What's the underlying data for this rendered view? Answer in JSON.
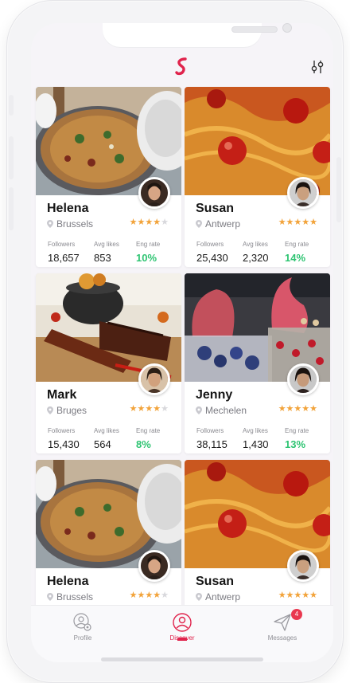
{
  "header": {
    "logo_icon": "app-logo-s-icon",
    "filter_icon": "filter-sliders-icon"
  },
  "labels": {
    "followers": "Followers",
    "avg_likes": "Avg likes",
    "eng_rate": "Eng rate"
  },
  "cards": [
    {
      "name": "Helena",
      "location": "Brussels",
      "rating": 4,
      "followers": "18,657",
      "avg_likes": "853",
      "eng_rate": "10%",
      "image": "pasta-pan"
    },
    {
      "name": "Susan",
      "location": "Antwerp",
      "rating": 5,
      "followers": "25,430",
      "avg_likes": "2,320",
      "eng_rate": "14%",
      "image": "spaghetti-tomato"
    },
    {
      "name": "Mark",
      "location": "Bruges",
      "rating": 4,
      "followers": "15,430",
      "avg_likes": "564",
      "eng_rate": "8%",
      "image": "grilled-meat"
    },
    {
      "name": "Jenny",
      "location": "Mechelen",
      "rating": 5,
      "followers": "38,115",
      "avg_likes": "1,430",
      "eng_rate": "13%",
      "image": "berry-dessert"
    },
    {
      "name": "Helena",
      "location": "Brussels",
      "rating": 4,
      "image": "pasta-pan"
    },
    {
      "name": "Susan",
      "location": "Antwerp",
      "rating": 5,
      "image": "spaghetti-tomato"
    }
  ],
  "tabs": [
    {
      "label": "Profile",
      "icon": "profile-gear-icon"
    },
    {
      "label": "Discover",
      "icon": "discover-user-icon",
      "active": true
    },
    {
      "label": "Messages",
      "icon": "paper-plane-icon",
      "badge": "4"
    }
  ],
  "colors": {
    "accent": "#e0234c",
    "star": "#f2a33a",
    "eng": "#2ec472"
  }
}
